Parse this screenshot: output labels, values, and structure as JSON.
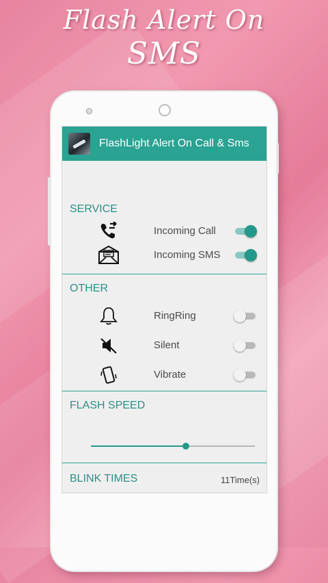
{
  "promo": {
    "title_line1": "Flash Alert On",
    "title_line2": "SMS"
  },
  "app": {
    "title": "FlashLight Alert On Call & Sms"
  },
  "sections": {
    "service": {
      "header": "SERVICE",
      "items": [
        {
          "label": "Incoming Call",
          "icon": "phone-call-icon",
          "enabled": true
        },
        {
          "label": "Incoming SMS",
          "icon": "envelope-icon",
          "enabled": true
        }
      ]
    },
    "other": {
      "header": "OTHER",
      "items": [
        {
          "label": "RingRing",
          "icon": "bell-icon",
          "enabled": false
        },
        {
          "label": "Silent",
          "icon": "muted-speaker-icon",
          "enabled": false
        },
        {
          "label": "Vibrate",
          "icon": "vibrate-phone-icon",
          "enabled": false
        }
      ]
    },
    "flash_speed": {
      "header": "FLASH SPEED",
      "level": 0.58
    },
    "blink_times": {
      "header": "BLINK TIMES",
      "value": "11Time(s)"
    }
  },
  "colors": {
    "accent": "#2aa393",
    "toggle_on": "#22998a",
    "background": "#e7849f"
  }
}
